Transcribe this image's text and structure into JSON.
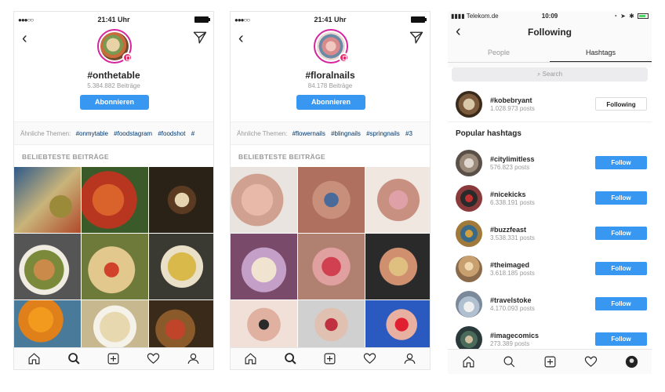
{
  "phone1": {
    "status": {
      "signal": "●●●○○",
      "time": "21:41 Uhr"
    },
    "hashtag": "#onthetable",
    "posts": "5.384.882 Beiträge",
    "subscribe_label": "Abonnieren",
    "related_label": "Ähnliche Themen:",
    "related_tags": [
      "#onmytable",
      "#foodstagram",
      "#foodshot",
      "#"
    ],
    "section_label": "BELIEBTESTE BEITRÄGE"
  },
  "phone2": {
    "status": {
      "signal": "●●●○○",
      "time": "21:41 Uhr"
    },
    "hashtag": "#floralnails",
    "posts": "84.178 Beiträge",
    "subscribe_label": "Abonnieren",
    "related_label": "Ähnliche Themen:",
    "related_tags": [
      "#flowernails",
      "#blingnails",
      "#springnails",
      "#3"
    ],
    "section_label": "BELIEBTESTE BEITRÄGE"
  },
  "phone3": {
    "status": {
      "carrier": "Telekom.de",
      "time": "10:09"
    },
    "title": "Following",
    "tabs": [
      "People",
      "Hashtags"
    ],
    "search_placeholder": "Search",
    "following": {
      "name": "#kobebryant",
      "count": "1.028.973 posts",
      "button": "Following"
    },
    "popular_label": "Popular hashtags",
    "popular": [
      {
        "name": "#citylimitless",
        "count": "576.823 posts",
        "button": "Follow"
      },
      {
        "name": "#nicekicks",
        "count": "6.338.191 posts",
        "button": "Follow"
      },
      {
        "name": "#buzzfeast",
        "count": "3.538.331 posts",
        "button": "Follow"
      },
      {
        "name": "#theimaged",
        "count": "3.618.185 posts",
        "button": "Follow"
      },
      {
        "name": "#travelstoke",
        "count": "4.170.093 posts",
        "button": "Follow"
      },
      {
        "name": "#imagecomics",
        "count": "273.389 posts",
        "button": "Follow"
      }
    ]
  },
  "colors": {
    "accent": "#3897f0",
    "link": "#003569",
    "muted": "#999999"
  }
}
